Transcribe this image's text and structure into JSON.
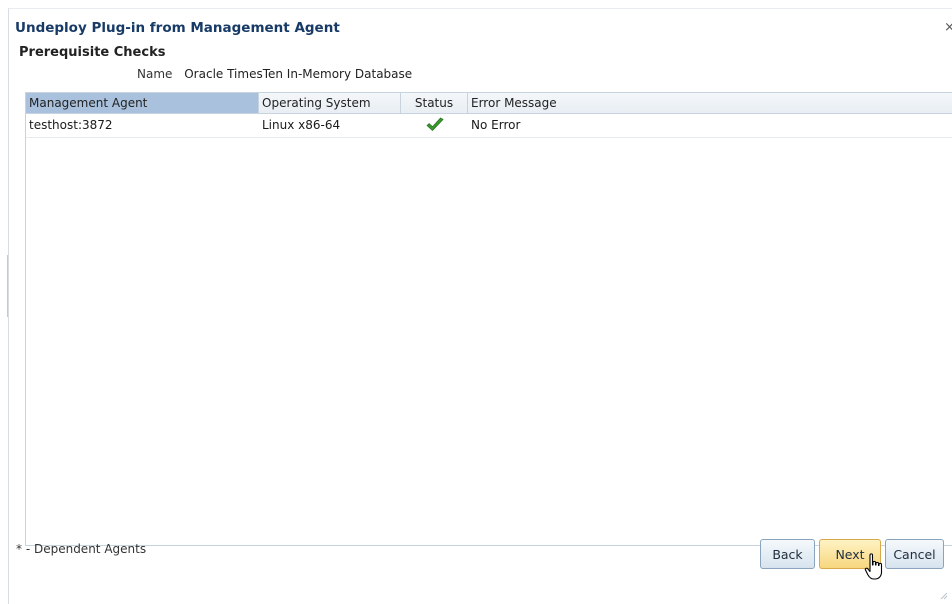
{
  "dialog": {
    "title": "Undeploy Plug-in from Management Agent",
    "close_label": "×",
    "subtitle": "Prerequisite Checks",
    "name_label": "Name",
    "name_value": "Oracle TimesTen In-Memory Database"
  },
  "table": {
    "columns": [
      "Management Agent",
      "Operating System",
      "Status",
      "Error Message"
    ],
    "rows": [
      {
        "agent": "testhost:3872",
        "os": "Linux x86-64",
        "status_icon": "check-icon",
        "error": "No Error"
      }
    ]
  },
  "footer": {
    "note": "* - Dependent Agents",
    "back_label": "Back",
    "next_label": "Next",
    "cancel_label": "Cancel"
  },
  "colors": {
    "title": "#173a66",
    "header_selected": "#a9c1dc",
    "check": "#3a9a2e",
    "next_button": "#f7d77e"
  }
}
